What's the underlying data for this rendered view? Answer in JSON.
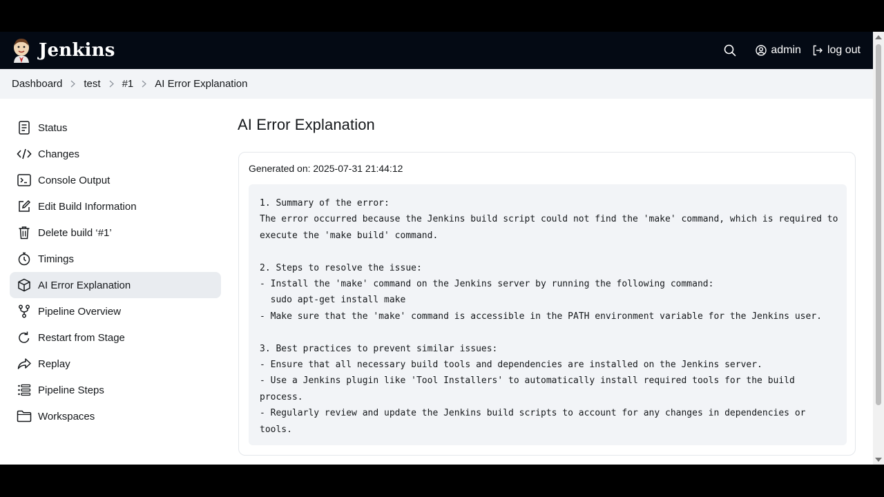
{
  "header": {
    "app_name": "Jenkins",
    "user_label": "admin",
    "logout_label": "log out"
  },
  "breadcrumb": [
    "Dashboard",
    "test",
    "#1",
    "AI Error Explanation"
  ],
  "sidebar": {
    "items": [
      {
        "label": "Status",
        "icon": "document-icon"
      },
      {
        "label": "Changes",
        "icon": "code-icon"
      },
      {
        "label": "Console Output",
        "icon": "terminal-icon"
      },
      {
        "label": "Edit Build Information",
        "icon": "edit-icon"
      },
      {
        "label": "Delete build ‘#1’",
        "icon": "trash-icon"
      },
      {
        "label": "Timings",
        "icon": "stopwatch-icon"
      },
      {
        "label": "AI Error Explanation",
        "icon": "cube-icon",
        "active": true
      },
      {
        "label": "Pipeline Overview",
        "icon": "branch-icon"
      },
      {
        "label": "Restart from Stage",
        "icon": "restart-icon"
      },
      {
        "label": "Replay",
        "icon": "replay-arrow-icon"
      },
      {
        "label": "Pipeline Steps",
        "icon": "list-icon"
      },
      {
        "label": "Workspaces",
        "icon": "folder-icon"
      }
    ]
  },
  "main": {
    "title": "AI Error Explanation",
    "generated": "Generated on: 2025-07-31 21:44:12",
    "explanation_lines": [
      "1. Summary of the error:",
      "The error occurred because the Jenkins build script could not find the 'make' command, which is required to",
      "execute the 'make build' command.",
      "",
      "2. Steps to resolve the issue:",
      "- Install the 'make' command on the Jenkins server by running the following command:",
      "  sudo apt-get install make",
      "- Make sure that the 'make' command is accessible in the PATH environment variable for the Jenkins user.",
      "",
      "3. Best practices to prevent similar issues:",
      "- Ensure that all necessary build tools and dependencies are installed on the Jenkins server.",
      "- Use a Jenkins plugin like 'Tool Installers' to automatically install required tools for the build",
      "process.",
      "- Regularly review and update the Jenkins build scripts to account for any changes in dependencies or",
      "tools."
    ]
  },
  "colors": {
    "header_bg": "#040a14",
    "breadcrumb_bg": "#f2f4f7",
    "active_item_bg": "#e9ecf0",
    "code_bg": "#f2f4f7"
  }
}
